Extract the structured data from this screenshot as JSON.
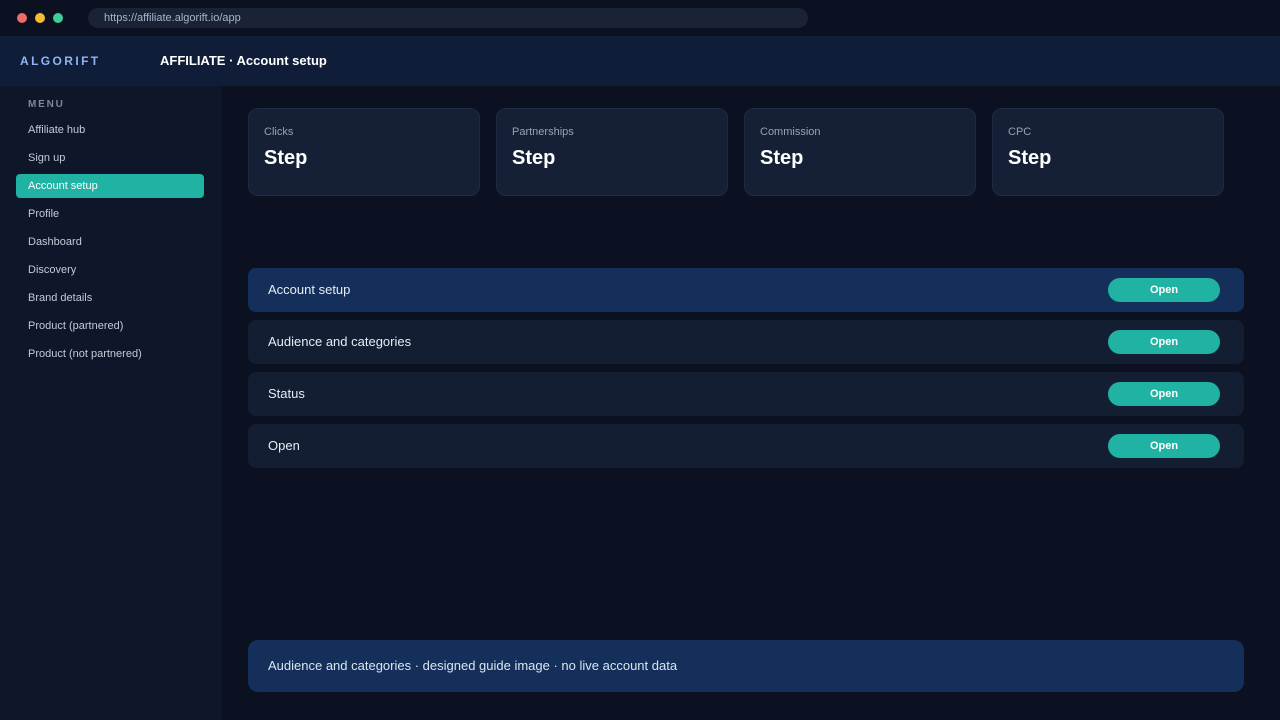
{
  "browser": {
    "url": "https://affiliate.algorift.io/app"
  },
  "header": {
    "brand": "ALGORIFT",
    "title": "AFFILIATE · Account setup"
  },
  "sidebar": {
    "heading": "MENU",
    "items": [
      {
        "label": "Affiliate hub",
        "active": false
      },
      {
        "label": "Sign up",
        "active": false
      },
      {
        "label": "Account setup",
        "active": true
      },
      {
        "label": "Profile",
        "active": false
      },
      {
        "label": "Dashboard",
        "active": false
      },
      {
        "label": "Discovery",
        "active": false
      },
      {
        "label": "Brand details",
        "active": false
      },
      {
        "label": "Product (partnered)",
        "active": false
      },
      {
        "label": "Product (not partnered)",
        "active": false
      }
    ]
  },
  "cards": [
    {
      "label": "Clicks",
      "value": "Step"
    },
    {
      "label": "Partnerships",
      "value": "Step"
    },
    {
      "label": "Commission",
      "value": "Step"
    },
    {
      "label": "CPC",
      "value": "Step"
    }
  ],
  "rows": [
    {
      "label": "Account setup",
      "button": "Open",
      "active": true
    },
    {
      "label": "Audience and categories",
      "button": "Open",
      "active": false
    },
    {
      "label": "Status",
      "button": "Open",
      "active": false
    },
    {
      "label": "Open",
      "button": "Open",
      "active": false
    }
  ],
  "footer": {
    "note": "Audience and categories · designed guide image · no live account data"
  },
  "colors": {
    "accent": "#20b3a3",
    "active_row": "#14305a",
    "background": "#0b1120"
  }
}
